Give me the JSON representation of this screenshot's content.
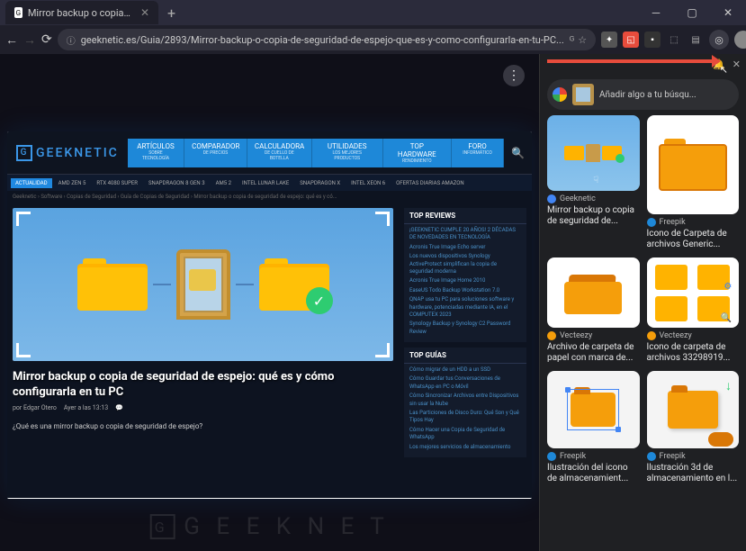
{
  "window": {
    "tab_title": "Mirror backup o copia de segu...",
    "url": "geeknetic.es/Guia/2893/Mirror-backup-o-copia-de-seguridad-de-espejo-que-es-y-como-configurarla-en-tu-PC..."
  },
  "lens": {
    "search_placeholder": "Añadir algo a tu búsqu...",
    "results": [
      {
        "source": "Geeknetic",
        "title": "Mirror backup o copia de seguridad de..."
      },
      {
        "source": "Freepik",
        "title": "Icono de Carpeta de archivos Generic..."
      },
      {
        "source": "Vecteezy",
        "title": "Archivo de carpeta de papel con marca de..."
      },
      {
        "source": "Vecteezy",
        "title": "Icono de carpeta de archivos 33298919..."
      },
      {
        "source": "Freepik",
        "title": "Ilustración del icono de almacenamient..."
      },
      {
        "source": "Freepik",
        "title": "Ilustración 3d de almacenamiento en l..."
      }
    ]
  },
  "site": {
    "logo": "GEEKNETIC",
    "nav": [
      {
        "label": "ARTÍCULOS",
        "sub": "SOBRE TECNOLOGÍA"
      },
      {
        "label": "COMPARADOR",
        "sub": "DE PRECIOS"
      },
      {
        "label": "CALCULADORA",
        "sub": "DE CUELLO DE BOTELLA"
      },
      {
        "label": "UTILIDADES",
        "sub": "LOS MEJORES PRODUCTOS"
      },
      {
        "label": "TOP HARDWARE",
        "sub": "RENDIMIENTO"
      },
      {
        "label": "FORO",
        "sub": "INFORMÁTICO"
      }
    ],
    "subnav": [
      "ACTUALIDAD",
      "AMD ZEN 5",
      "RTX 4080 SUPER",
      "SNAPDRAGON 8 GEN 3",
      "AM5 2",
      "INTEL LUNAR LAKE",
      "SNAPDRAGON X",
      "INTEL XEON 6",
      "OFERTAS DIARIAS AMAZON"
    ],
    "breadcrumb": "Geeknetic › Software › Copias de Seguridad › Guía de Copias de Seguridad › Mirror backup o copia de seguridad de espejo: qué es y có...",
    "article": {
      "title": "Mirror backup o copia de seguridad de espejo: qué es y cómo configurarla en tu PC",
      "author": "por Edgar Otero",
      "date": "Ayer a las 13:13",
      "question": "¿Qué es una mirror backup o copia de seguridad de espejo?"
    },
    "top_reviews": {
      "header": "TOP REVIEWS",
      "items": [
        "¡GEEKNETIC CUMPLE 20 AÑOS! 2 DÉCADAS DE NOVEDADES EN TECNOLOGÍA",
        "Acronis True Image Echo server",
        "Los nuevos dispositivos Synology ActiveProtect simplifican la copia de seguridad moderna",
        "Acronis True Image Home 2010",
        "EaseUS Todo Backup Workstation 7.0",
        "QNAP usa tu PC para soluciones software y hardware, potenciadas mediante IA, en el COMPUTEX 2023",
        "Synology Backup y Synology C2 Password Review"
      ]
    },
    "top_guias": {
      "header": "TOP GUÍAS",
      "items": [
        "Cómo migrar de un HDD a un SSD",
        "Cómo Guardar tus Conversaciones de WhatsApp en PC o Móvil",
        "Cómo Sincronizar Archivos entre Dispositivos sin usar la Nube",
        "Las Particiones de Disco Duro: Qué Son y Qué Tipos Hay",
        "Cómo Hacer una Copia de Seguridad de WhatsApp",
        "Los mejores servicios de almacenamiento"
      ]
    }
  }
}
